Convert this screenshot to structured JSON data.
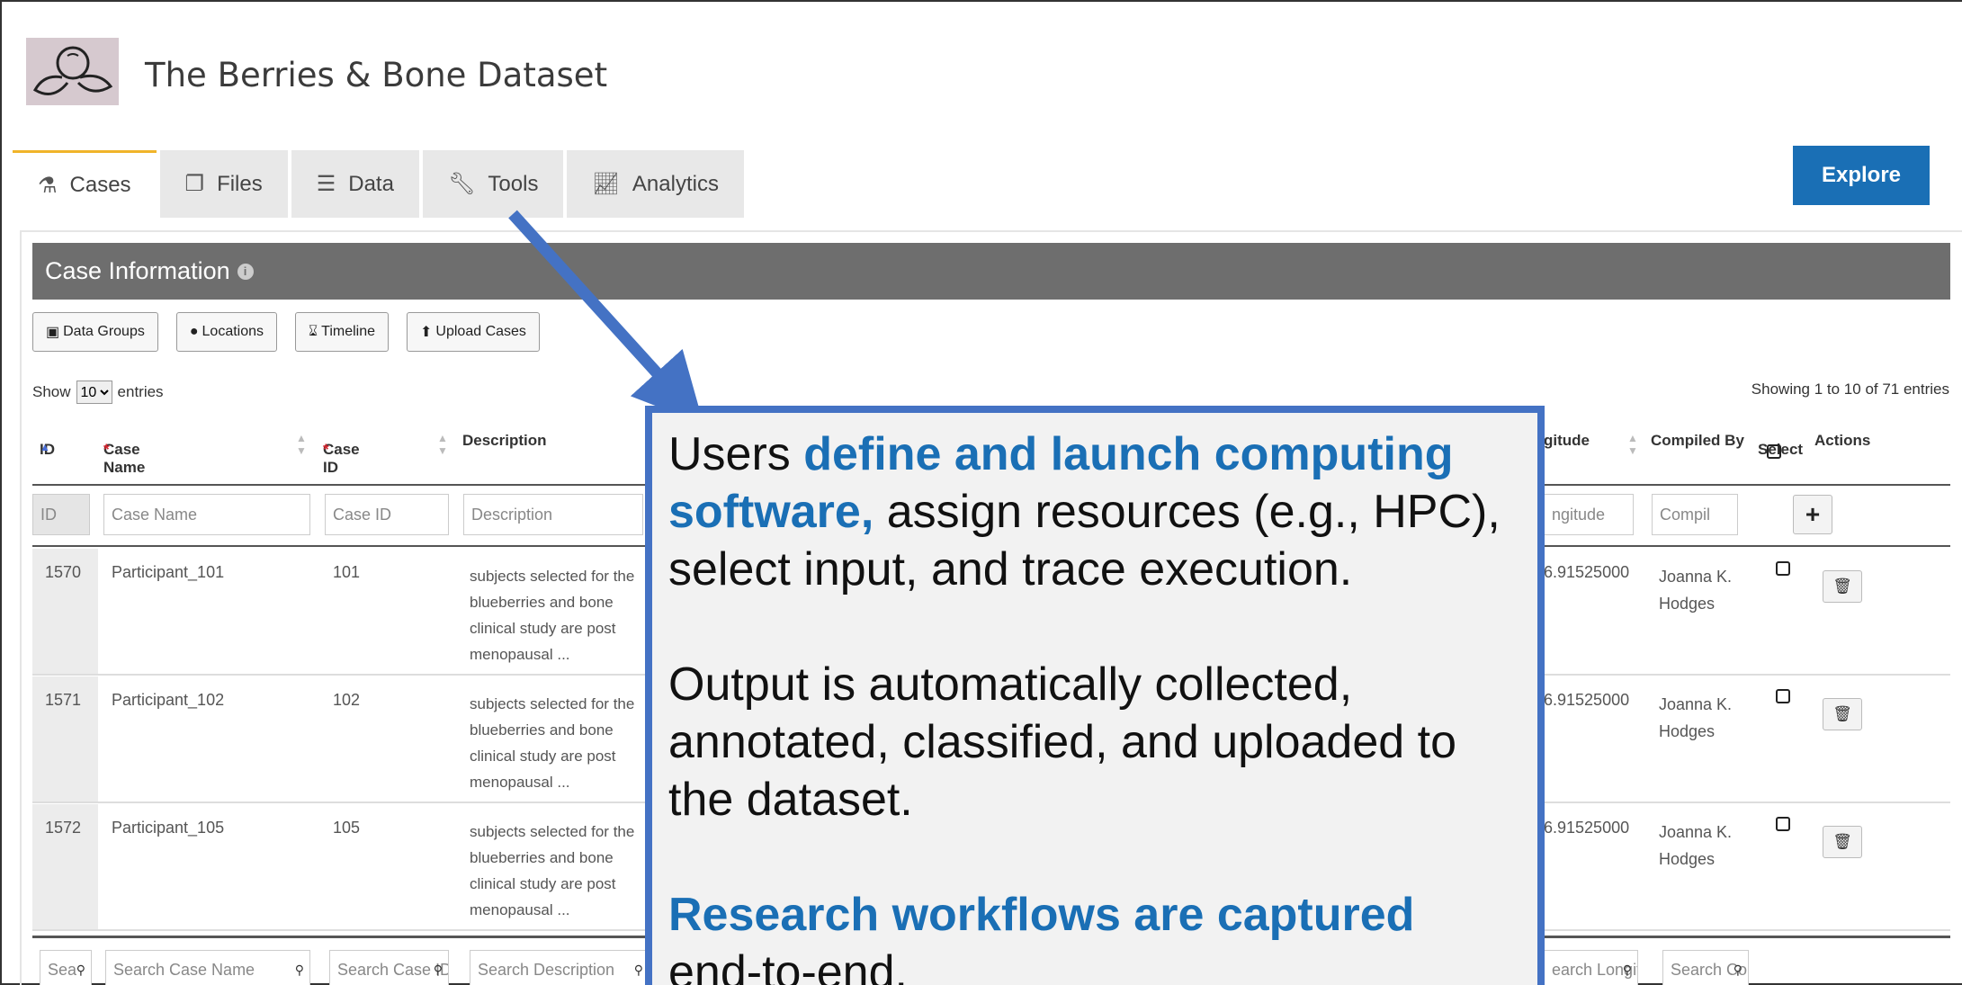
{
  "header": {
    "title": "The Berries & Bone Dataset"
  },
  "tabs": [
    {
      "label": "Cases",
      "icon": "flask-icon"
    },
    {
      "label": "Files",
      "icon": "files-icon"
    },
    {
      "label": "Data",
      "icon": "database-icon"
    },
    {
      "label": "Tools",
      "icon": "wrench-icon"
    },
    {
      "label": "Analytics",
      "icon": "chart-line-icon"
    }
  ],
  "explore_label": "Explore",
  "panel": {
    "title": "Case Information",
    "buttons": [
      "Data Groups",
      "Locations",
      "Timeline",
      "Upload Cases"
    ]
  },
  "length": {
    "show": "Show",
    "value": "10",
    "entries": "entries"
  },
  "showing": "Showing 1 to 10 of 71 entries",
  "columns": {
    "id": "ID",
    "case_name": "Case Name",
    "case_id": "Case ID",
    "description": "Description",
    "longitude": "gitude",
    "compiled_by": "Compiled By",
    "select": "Select",
    "actions": "Actions"
  },
  "filters": {
    "id": "ID",
    "case_name": "Case Name",
    "case_id": "Case ID",
    "description": "Description",
    "longitude": "ngitude",
    "compiled_by": "Compil"
  },
  "rows": [
    {
      "id": "1570",
      "name": "Participant_101",
      "case_id": "101",
      "desc": "subjects selected for the blueberries and bone clinical study are post menopausal",
      "more": "...",
      "longitude": "6.91525000",
      "compiled_by_1": "Joanna K.",
      "compiled_by_2": "Hodges"
    },
    {
      "id": "1571",
      "name": "Participant_102",
      "case_id": "102",
      "desc": "subjects selected for the blueberries and bone clinical study are post menopausal",
      "more": "...",
      "longitude": "6.91525000",
      "compiled_by_1": "Joanna K.",
      "compiled_by_2": "Hodges"
    },
    {
      "id": "1572",
      "name": "Participant_105",
      "case_id": "105",
      "desc": "subjects selected for the blueberries and bone clinical study are post menopausal",
      "more": "...",
      "longitude": "6.91525000",
      "compiled_by_1": "Joanna K.",
      "compiled_by_2": "Hodges"
    }
  ],
  "search": {
    "id": "Sea",
    "case_name": "Search Case Name",
    "case_id": "Search Case ID",
    "description": "Search Description",
    "longitude": "earch Longit",
    "compiled_by": "Search Co"
  },
  "callout": {
    "p1_a": "Users ",
    "p1_b": "define and launch computing software,",
    "p1_c": " assign resources (e.g., HPC), select input, and trace execution.",
    "p2": "Output is automatically collected, annotated, classified, and uploaded to the dataset.",
    "p3_a": "Research workflows are captured",
    "p3_b": "end-to-end."
  },
  "colors": {
    "accent": "#1a6fb5",
    "callout_border": "#4472c4",
    "panel_header": "#6e6e6e",
    "active_tab": "#f0b42a"
  }
}
